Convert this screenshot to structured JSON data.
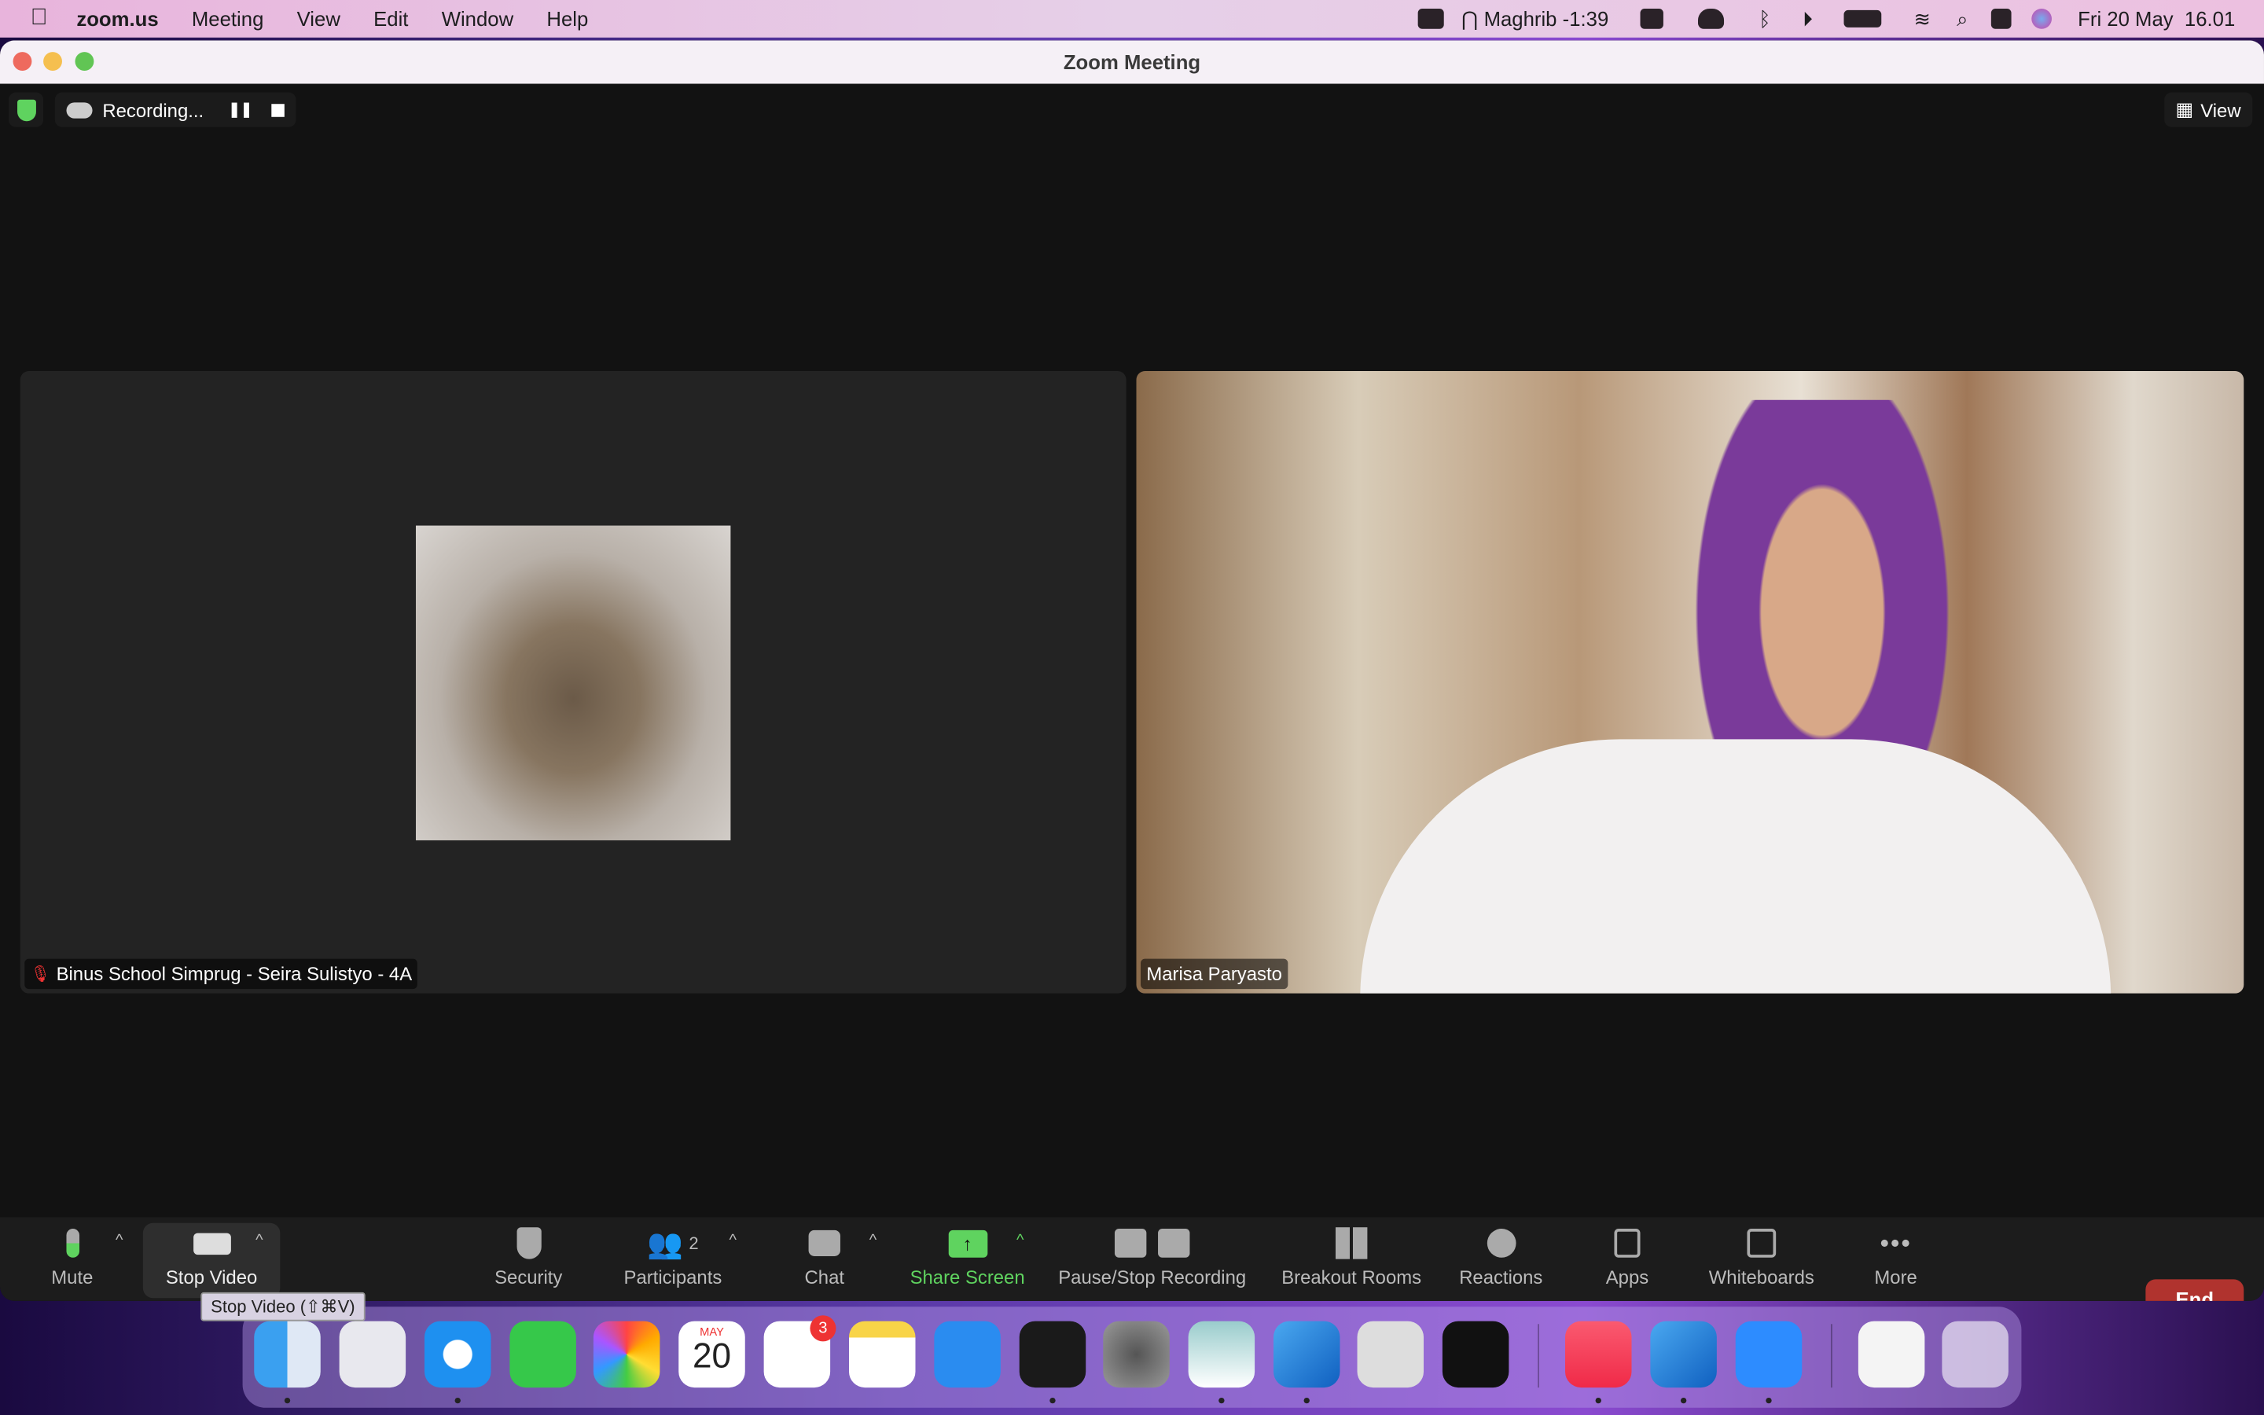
{
  "menubar": {
    "app": "zoom.us",
    "items": [
      "Meeting",
      "View",
      "Edit",
      "Window",
      "Help"
    ],
    "prayer": "Maghrib -1:39",
    "datetime": "Fri 20 May  16.01"
  },
  "window": {
    "title": "Zoom Meeting"
  },
  "recording": {
    "label": "Recording..."
  },
  "view_label": "View",
  "participants": [
    {
      "name": "Binus School Simprug - Seira Sulistyo - 4A",
      "muted": true
    },
    {
      "name": "Marisa Paryasto",
      "muted": false
    }
  ],
  "toolbar": {
    "mute": "Mute",
    "stop_video": "Stop Video",
    "security": "Security",
    "participants": "Participants",
    "participant_count": "2",
    "chat": "Chat",
    "share_screen": "Share Screen",
    "recording": "Pause/Stop Recording",
    "breakout": "Breakout Rooms",
    "reactions": "Reactions",
    "apps": "Apps",
    "whiteboards": "Whiteboards",
    "more": "More",
    "end": "End"
  },
  "tooltip": "Stop Video (⇧⌘V)",
  "colors": {
    "accent_green": "#5fd35f",
    "end_red": "#b0332e"
  },
  "dock": {
    "calendar_month": "MAY",
    "calendar_day": "20",
    "reminders_badge": "3",
    "apps": [
      "finder",
      "launchpad",
      "safari",
      "messages",
      "photos",
      "calendar",
      "reminders",
      "notes",
      "keynote",
      "terminal",
      "system-preferences",
      "preview",
      "roblox-studio",
      "roblox",
      "activity-monitor",
      "music",
      "roblox-studio",
      "zoom",
      "document",
      "trash"
    ]
  }
}
